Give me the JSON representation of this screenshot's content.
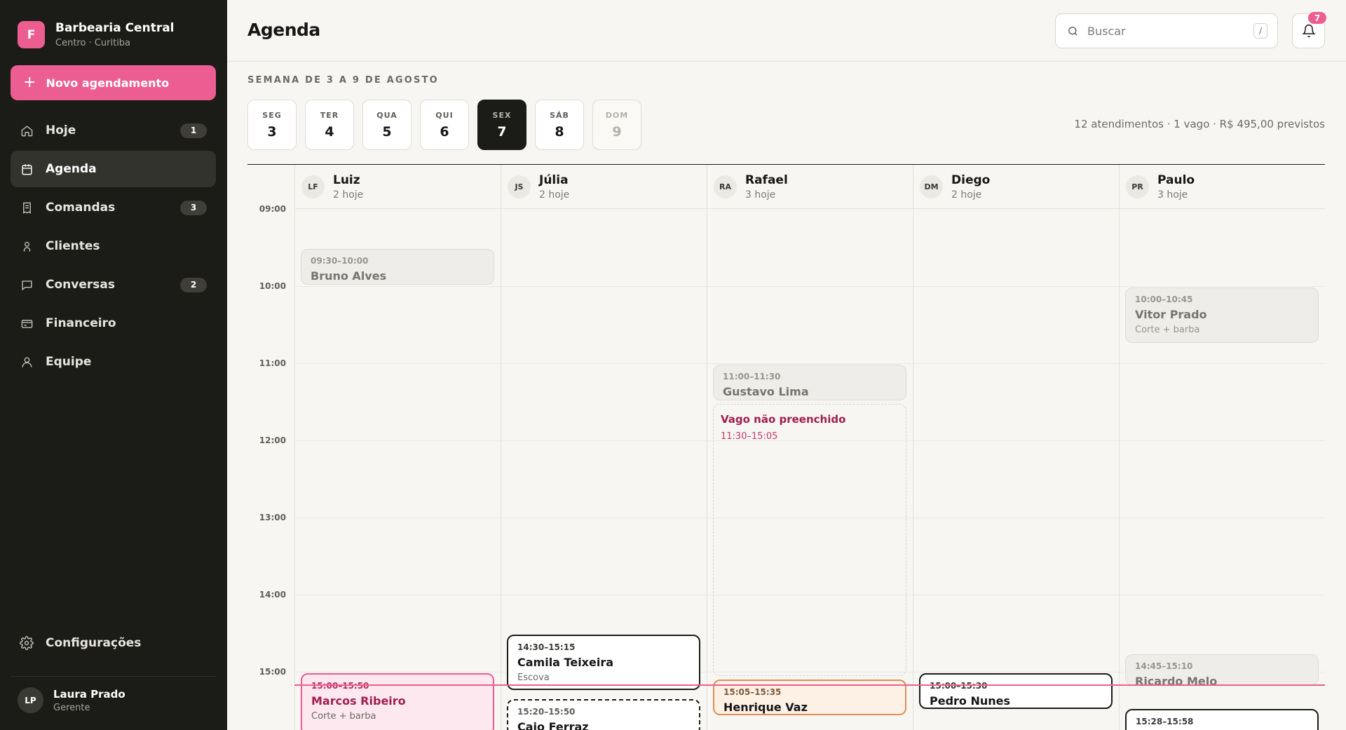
{
  "sidebar": {
    "brand": {
      "initial": "F",
      "name": "Barbearia Central",
      "location": "Centro · Curitiba"
    },
    "new_button": {
      "icon": "plus-icon",
      "label": "Novo agendamento"
    },
    "nav": [
      {
        "label": "Hoje",
        "icon": "home-icon",
        "badge": "1",
        "active": false
      },
      {
        "label": "Agenda",
        "icon": "calendar-icon",
        "badge": null,
        "active": true
      },
      {
        "label": "Comandas",
        "icon": "receipt-icon",
        "badge": "3",
        "active": false
      },
      {
        "label": "Clientes",
        "icon": "client-icon",
        "badge": null,
        "active": false
      },
      {
        "label": "Conversas",
        "icon": "chat-icon",
        "badge": "2",
        "active": false
      },
      {
        "label": "Financeiro",
        "icon": "card-icon",
        "badge": null,
        "active": false
      },
      {
        "label": "Equipe",
        "icon": "team-icon",
        "badge": null,
        "active": false
      }
    ],
    "settings_label": "Configurações",
    "user": {
      "initials": "LP",
      "name": "Laura Prado",
      "role": "Gerente"
    }
  },
  "header": {
    "title": "Agenda",
    "search": {
      "placeholder": "Buscar",
      "value": "",
      "shortcut": "/"
    },
    "notifications": {
      "count": "7"
    }
  },
  "week": {
    "label": "SEMANA DE 3 A 9 DE AGOSTO",
    "days": [
      {
        "name": "SEG",
        "num": "3",
        "state": "normal"
      },
      {
        "name": "TER",
        "num": "4",
        "state": "normal"
      },
      {
        "name": "QUA",
        "num": "5",
        "state": "normal"
      },
      {
        "name": "QUI",
        "num": "6",
        "state": "normal"
      },
      {
        "name": "SEX",
        "num": "7",
        "state": "active"
      },
      {
        "name": "SÁB",
        "num": "8",
        "state": "normal"
      },
      {
        "name": "DOM",
        "num": "9",
        "state": "disabled"
      }
    ],
    "summary": "12 atendimentos · 1 vago · R$ 495,00 previstos"
  },
  "calendar": {
    "hours": [
      "09:00",
      "10:00",
      "11:00",
      "12:00",
      "13:00",
      "14:00",
      "15:00"
    ],
    "now": "15:10",
    "professionals": [
      {
        "initials": "LF",
        "name": "Luiz",
        "count": "2 hoje"
      },
      {
        "initials": "JS",
        "name": "Júlia",
        "count": "2 hoje"
      },
      {
        "initials": "RA",
        "name": "Rafael",
        "count": "3 hoje"
      },
      {
        "initials": "DM",
        "name": "Diego",
        "count": "2 hoje"
      },
      {
        "initials": "PR",
        "name": "Paulo",
        "count": "3 hoje"
      }
    ],
    "appointments": [
      {
        "col": 0,
        "start": "09:30",
        "end": "10:00",
        "time": "09:30–10:00",
        "client": "Bruno Alves",
        "service": "",
        "state": "past"
      },
      {
        "col": 0,
        "start": "15:00",
        "end": "15:50",
        "time": "15:00–15:50",
        "client": "Marcos Ribeiro",
        "service": "Corte + barba",
        "state": "pink"
      },
      {
        "col": 1,
        "start": "14:30",
        "end": "15:15",
        "time": "14:30–15:15",
        "client": "Camila Teixeira",
        "service": "Escova",
        "state": "active"
      },
      {
        "col": 1,
        "start": "15:20",
        "end": "15:50",
        "time": "15:20–15:50",
        "client": "Caio Ferraz",
        "service": "",
        "state": "dashed"
      },
      {
        "col": 2,
        "start": "11:00",
        "end": "11:30",
        "time": "11:00–11:30",
        "client": "Gustavo Lima",
        "service": "",
        "state": "past"
      },
      {
        "col": 2,
        "start": "15:05",
        "end": "15:35",
        "time": "15:05–15:35",
        "client": "Henrique Vaz",
        "service": "",
        "state": "orange"
      },
      {
        "col": 3,
        "start": "15:00",
        "end": "15:30",
        "time": "15:00–15:30",
        "client": "Pedro Nunes",
        "service": "",
        "state": "active"
      },
      {
        "col": 4,
        "start": "10:00",
        "end": "10:45",
        "time": "10:00–10:45",
        "client": "Vitor Prado",
        "service": "Corte + barba",
        "state": "past"
      },
      {
        "col": 4,
        "start": "14:45",
        "end": "15:10",
        "time": "14:45–15:10",
        "client": "Ricardo Melo",
        "service": "",
        "state": "past"
      },
      {
        "col": 4,
        "start": "15:28",
        "end": "15:58",
        "time": "15:28–15:58",
        "client": "",
        "service": "",
        "state": "active"
      }
    ],
    "vacancy": {
      "col": 2,
      "start": "11:30",
      "end": "15:05",
      "title": "Vago não preenchido",
      "time": "11:30–15:05"
    }
  },
  "colors": {
    "accent": "#ec5e91",
    "sidebar_bg": "#1b1b17",
    "active_dark": "#1b1b17",
    "now_line": "#ec5e91"
  }
}
